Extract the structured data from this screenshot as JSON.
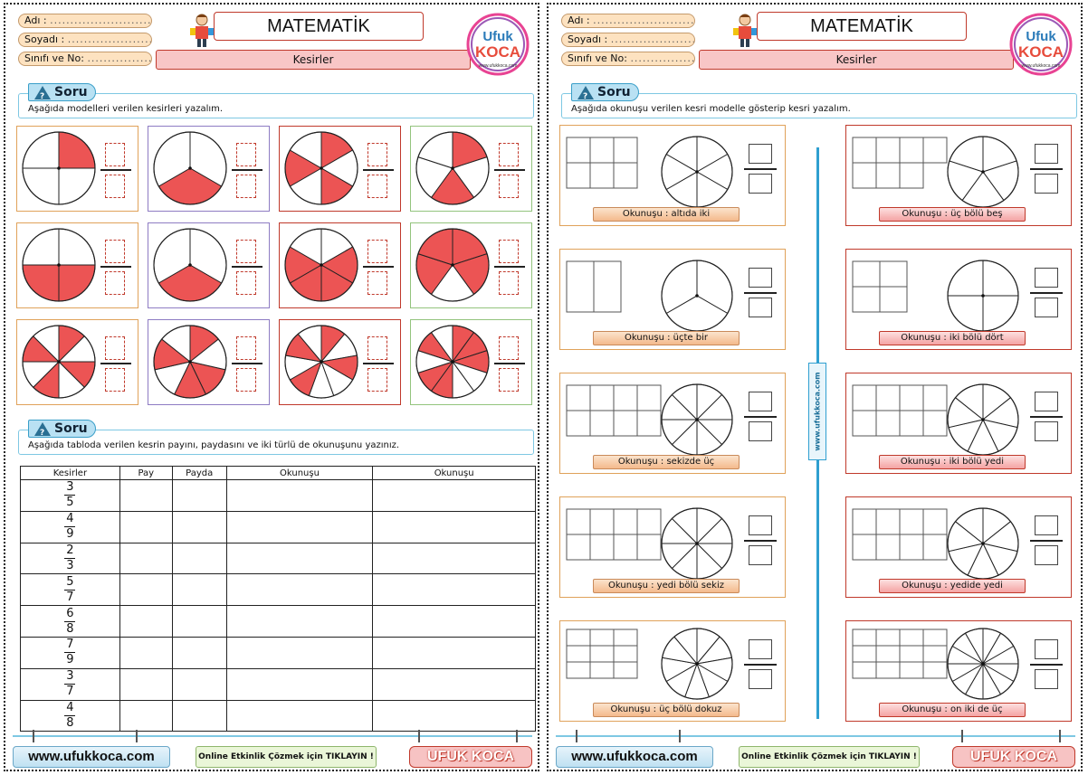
{
  "header": {
    "name_label": "Adı",
    "surname_label": "Soyadı",
    "class_label": "Sınıfı ve No:",
    "dots": "...............................",
    "title": "MATEMATİK",
    "subtitle": "Kesirler",
    "logo_top": "Ufuk",
    "logo_bottom": "KOCA",
    "logo_url": "www.ufukkoca.com"
  },
  "left": {
    "section1": {
      "tag": "Soru",
      "instruction": "Aşağıda modelleri verilen kesirleri yazalım."
    },
    "circles": [
      {
        "parts": 4,
        "shaded": [
          0
        ],
        "border": "#e0a25a"
      },
      {
        "parts": 3,
        "shaded": [
          1
        ],
        "border": "#8e7cc3"
      },
      {
        "parts": 6,
        "shaded": [
          0,
          2,
          4
        ],
        "border": "#c0392b"
      },
      {
        "parts": 5,
        "shaded": [
          0,
          2
        ],
        "border": "#93c47d"
      },
      {
        "parts": 4,
        "shaded": [
          1,
          2
        ],
        "border": "#e0a25a"
      },
      {
        "parts": 3,
        "shaded": [
          1
        ],
        "border": "#8e7cc3"
      },
      {
        "parts": 6,
        "shaded": [
          1,
          2,
          3,
          4
        ],
        "border": "#c0392b"
      },
      {
        "parts": 5,
        "shaded": [
          0,
          1,
          3,
          4
        ],
        "border": "#93c47d"
      },
      {
        "parts": 8,
        "shaded": [
          0,
          2,
          4,
          6
        ],
        "border": "#e0a25a"
      },
      {
        "parts": 7,
        "shaded": [
          0,
          2,
          3,
          5
        ],
        "border": "#8e7cc3"
      },
      {
        "parts": 9,
        "shaded": [
          0,
          2,
          5,
          7
        ],
        "border": "#c0392b"
      },
      {
        "parts": 10,
        "shaded": [
          0,
          1,
          2,
          5,
          6,
          8
        ],
        "border": "#93c47d"
      }
    ],
    "section2": {
      "tag": "Soru",
      "instruction": "Aşağıda tabloda verilen kesrin payını, paydasını ve iki türlü de okunuşunu yazınız."
    },
    "table": {
      "headers": [
        "Kesirler",
        "Pay",
        "Payda",
        "Okunuşu",
        "Okunuşu"
      ],
      "rows": [
        {
          "num": "3",
          "den": "5"
        },
        {
          "num": "4",
          "den": "9"
        },
        {
          "num": "2",
          "den": "3"
        },
        {
          "num": "5",
          "den": "7"
        },
        {
          "num": "6",
          "den": "8"
        },
        {
          "num": "7",
          "den": "9"
        },
        {
          "num": "3",
          "den": "7"
        },
        {
          "num": "4",
          "den": "8"
        }
      ]
    }
  },
  "right": {
    "section1": {
      "tag": "Soru",
      "instruction": "Aşağıda okunuşu verilen kesri modelle gösterip kesri yazalım."
    },
    "vertical_web": "www.ufukkoca.com",
    "cards": [
      {
        "text": "Okunuşu  :  altıda iki",
        "cols": 3,
        "rows": 2,
        "circle": 6,
        "style": "orange"
      },
      {
        "text": "Okunuşu  :  üç bölü beş",
        "cols": 3,
        "rows": 2,
        "extra": true,
        "circle": 5,
        "style": "pink"
      },
      {
        "text": "Okunuşu  :  üçte bir",
        "cols": 2,
        "rows": 1,
        "circle": 3,
        "style": "orange"
      },
      {
        "text": "Okunuşu  :  iki bölü dört",
        "cols": 2,
        "rows": 2,
        "circle": 4,
        "style": "pink"
      },
      {
        "text": "Okunuşu  :  sekizde üç",
        "cols": 4,
        "rows": 2,
        "circle": 8,
        "style": "orange"
      },
      {
        "text": "Okunuşu  :  iki bölü yedi",
        "cols": 4,
        "rows": 2,
        "circle": 7,
        "style": "pink"
      },
      {
        "text": "Okunuşu  :  yedi bölü sekiz",
        "cols": 4,
        "rows": 2,
        "circle": 8,
        "style": "orange"
      },
      {
        "text": "Okunuşu  :  yedide yedi",
        "cols": 4,
        "rows": 2,
        "circle": 7,
        "style": "pink"
      },
      {
        "text": "Okunuşu  :  üç bölü dokuz",
        "cols": 3,
        "rows": 3,
        "circle": 9,
        "style": "orange"
      },
      {
        "text": "Okunuşu  :  on iki de üç",
        "cols": 4,
        "rows": 3,
        "circle": 12,
        "style": "pink"
      }
    ]
  },
  "footer": {
    "website": "www.ufukkoca.com",
    "online": "Online Etkinlik Çözmek için TIKLAYIN !",
    "brand": "UFUK KOCA"
  },
  "colors": {
    "shade": "#ec5454",
    "accent": "#2f9fd0",
    "header_bg": "#f8c6c6"
  }
}
